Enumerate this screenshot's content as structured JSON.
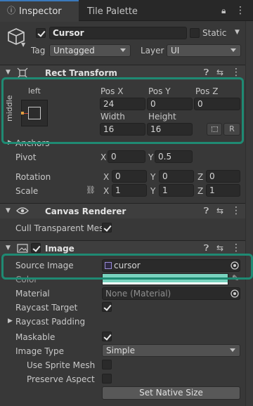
{
  "tabs": {
    "inspector": "Inspector",
    "tile_palette": "Tile Palette"
  },
  "object": {
    "name": "Cursor",
    "static_label": "Static",
    "tag_label": "Tag",
    "tag_value": "Untagged",
    "layer_label": "Layer",
    "layer_value": "UI"
  },
  "rect_transform": {
    "title": "Rect Transform",
    "anchor_h": "left",
    "anchor_v": "middle",
    "pos_x_label": "Pos X",
    "pos_y_label": "Pos Y",
    "pos_z_label": "Pos Z",
    "pos_x": "24",
    "pos_y": "0",
    "pos_z": "0",
    "width_label": "Width",
    "height_label": "Height",
    "width": "16",
    "height": "16",
    "r_button": "R",
    "anchors_label": "Anchors",
    "pivot_label": "Pivot",
    "pivot_x": "0",
    "pivot_y": "0.5",
    "rotation_label": "Rotation",
    "rot_x": "0",
    "rot_y": "0",
    "rot_z": "0",
    "scale_label": "Scale",
    "scale_x": "1",
    "scale_y": "1",
    "scale_z": "1",
    "x": "X",
    "y": "Y",
    "z": "Z"
  },
  "canvas_renderer": {
    "title": "Canvas Renderer",
    "cull_label": "Cull Transparent Mes"
  },
  "image": {
    "title": "Image",
    "source_label": "Source Image",
    "source_value": "cursor",
    "color_label": "Color",
    "color_value": "#79d3bf",
    "material_label": "Material",
    "material_value": "None (Material)",
    "raycast_target_label": "Raycast Target",
    "raycast_padding_label": "Raycast Padding",
    "maskable_label": "Maskable",
    "image_type_label": "Image Type",
    "image_type_value": "Simple",
    "use_sprite_mesh_label": "Use Sprite Mesh",
    "preserve_aspect_label": "Preserve Aspect",
    "native_size_button": "Set Native Size"
  },
  "colors": {
    "accent": "#3a79bb",
    "highlight": "#1f8a73",
    "field_bg": "#2a2a2a",
    "panel_bg": "#383838"
  },
  "icons": [
    "cube-icon",
    "lock-icon",
    "menu-icon",
    "help-icon",
    "preset-icon",
    "kebab-icon",
    "eye-icon",
    "image-icon",
    "dropper-icon",
    "target-icon",
    "link-icon"
  ]
}
